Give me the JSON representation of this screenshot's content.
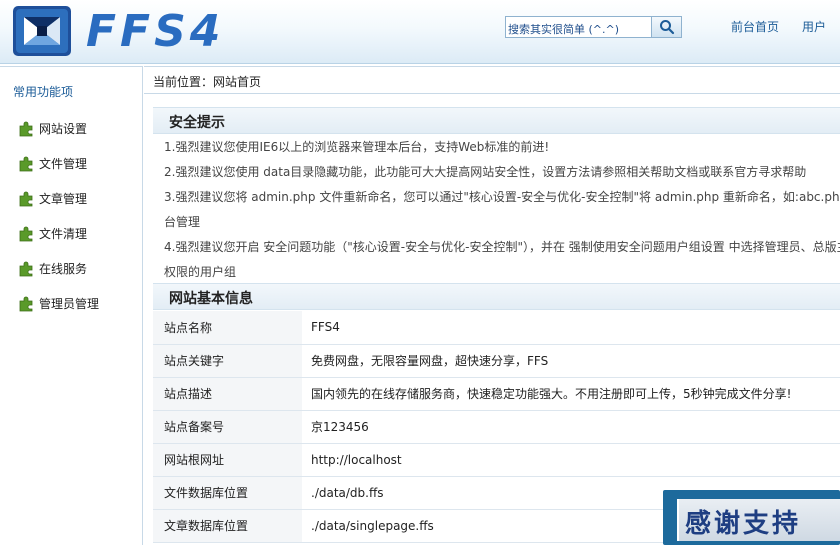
{
  "header": {
    "brand": "FFS4",
    "search_placeholder": "搜索其实很简单 (^.^)",
    "nav_home": "前台首页",
    "nav_user": "用户"
  },
  "sidebar": {
    "title": "常用功能项",
    "items": [
      {
        "label": "网站设置"
      },
      {
        "label": "文件管理"
      },
      {
        "label": "文章管理"
      },
      {
        "label": "文件清理"
      },
      {
        "label": "在线服务"
      },
      {
        "label": "管理员管理"
      }
    ]
  },
  "main": {
    "breadcrumb": "当前位置：网站首页",
    "security": {
      "title": "安全提示",
      "tip1": "1.强烈建议您使用IE6以上的浏览器来管理本后台，支持Web标准的前进!",
      "tip2": "2.强烈建议您使用 data目录隐藏功能，此功能可大大提高网站安全性，设置方法请参照相关帮助文档或联系官方寻求帮助",
      "tip3": "3.强烈建议您将 admin.php 文件重新命名，您可以通过\"核心设置-安全与优化-安全控制\"将 admin.php 重新命名，如:abc.php，这",
      "tip3b": "台管理",
      "tip4": "4.强烈建议您开启 安全问题功能（\"核心设置-安全与优化-安全控制\"），并在 强制使用安全问题用户组设置 中选择管理员、总版主",
      "tip4b": "权限的用户组"
    },
    "info": {
      "title": "网站基本信息",
      "rows": [
        {
          "key": "站点名称",
          "value": "FFS4"
        },
        {
          "key": "站点关键字",
          "value": "免费网盘，无限容量网盘，超快速分享，FFS"
        },
        {
          "key": "站点描述",
          "value": "国内领先的在线存储服务商，快速稳定功能强大。不用注册即可上传，5秒钟完成文件分享!"
        },
        {
          "key": "站点备案号",
          "value": "京123456"
        },
        {
          "key": "网站根网址",
          "value": "http://localhost"
        },
        {
          "key": "文件数据库位置",
          "value": "./data/db.ffs"
        },
        {
          "key": "文章数据库位置",
          "value": "./data/singlepage.ffs"
        }
      ]
    }
  },
  "badge": {
    "text": "感谢支持"
  },
  "colors": {
    "brand_blue": "#1c5c98",
    "header_gradient_end": "#dcebf6",
    "badge_bg": "#1d6a9c"
  }
}
